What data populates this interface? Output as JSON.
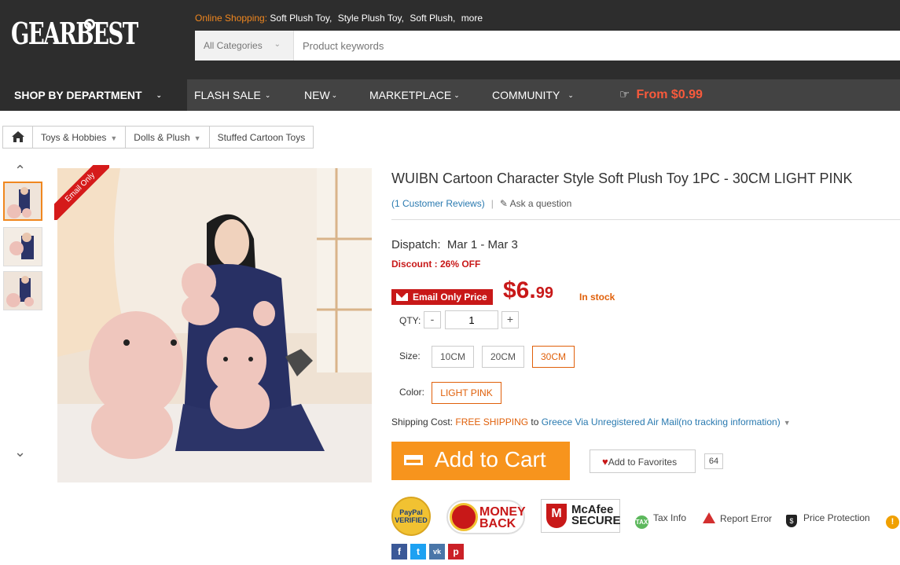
{
  "header": {
    "logo": "GEARBEST",
    "online_label": "Online Shopping:",
    "keywords": [
      "Soft Plush Toy,",
      "Style Plush Toy,",
      "Soft Plush,",
      "more"
    ],
    "category_select": "All Categories",
    "search_placeholder": "Product keywords"
  },
  "nav": {
    "department": "SHOP BY DEPARTMENT",
    "items": [
      "FLASH SALE",
      "NEW",
      "MARKETPLACE",
      "COMMUNITY"
    ],
    "promo": "From $0.99"
  },
  "breadcrumb": [
    "Toys & Hobbies",
    "Dolls & Plush",
    "Stuffed Cartoon Toys"
  ],
  "gallery": {
    "ribbon": "Email Only",
    "thumb_count": 3,
    "selected_thumb": 0
  },
  "product": {
    "title": "WUIBN Cartoon Character Style Soft Plush Toy 1PC  -  30CM  LIGHT PINK",
    "reviews": "(1 Customer Reviews)",
    "ask": "Ask a question",
    "dispatch_label": "Dispatch:",
    "dispatch_value": "Mar 1 - Mar 3",
    "discount": "Discount : 26% OFF",
    "email_price_label": "Email Only Price",
    "price_main": "$6.",
    "price_cents": "99",
    "stock": "In stock",
    "qty_label": "QTY:",
    "qty_value": "1",
    "qty_minus": "-",
    "qty_plus": "+",
    "size_label": "Size:",
    "sizes": [
      "10CM",
      "20CM",
      "30CM"
    ],
    "selected_size": "30CM",
    "color_label": "Color:",
    "colors": [
      "LIGHT PINK"
    ],
    "shipping_label": "Shipping Cost:",
    "shipping_free": "FREE SHIPPING",
    "shipping_to": "to",
    "shipping_dest": "Greece Via Unregistered Air Mail(no tracking information)",
    "add_to_cart": "Add to Cart",
    "favorites": "Add to Favorites",
    "favorites_count": "64"
  },
  "badges": {
    "paypal": "PayPal VERIFIED",
    "money_back": "MONEY BACK",
    "mcafee": "McAfee SECURE"
  },
  "info_links": [
    "Tax Info",
    "Report Error",
    "Price Protection"
  ],
  "social": [
    "f",
    "t",
    "vk",
    "p"
  ],
  "colors": {
    "header_bg": "#2d2d2d",
    "nav_bg": "#434343",
    "accent_orange": "#f7941d",
    "price_red": "#c81818",
    "link_blue": "#2a7ab0"
  }
}
